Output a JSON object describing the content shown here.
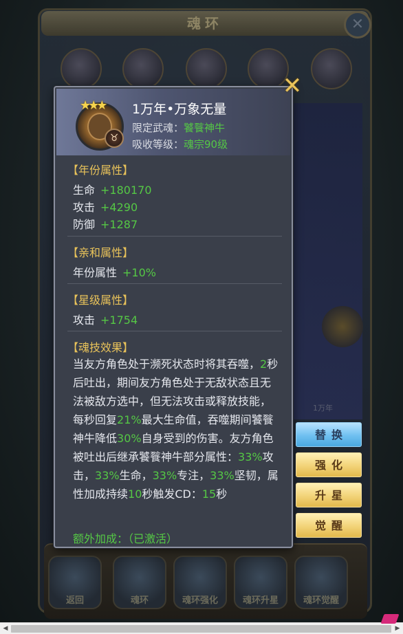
{
  "background": {
    "window_title": "魂环",
    "faint_label": "1万年",
    "bottom_nav": [
      {
        "label": "返回"
      },
      {
        "label": "魂环"
      },
      {
        "label": "魂环强化"
      },
      {
        "label": "魂环升星"
      },
      {
        "label": "魂环觉醒"
      }
    ]
  },
  "popup": {
    "stars": 3,
    "ring_name": "1万年•万象无量",
    "limit_label": "限定武魂：",
    "limit_value": "饕餮神牛",
    "absorb_label": "吸收等级：",
    "absorb_value": "魂宗90级",
    "year_attr": {
      "title": "【年份属性】",
      "items": [
        {
          "name": "生命",
          "value": "+180170"
        },
        {
          "name": "攻击",
          "value": "+4290"
        },
        {
          "name": "防御",
          "value": "+1287"
        }
      ]
    },
    "affinity_attr": {
      "title": "【亲和属性】",
      "items": [
        {
          "name": "年份属性",
          "value": "+10%"
        }
      ]
    },
    "star_attr": {
      "title": "【星级属性】",
      "items": [
        {
          "name": "攻击",
          "value": "+1754"
        }
      ]
    },
    "skill": {
      "title": "【魂技效果】",
      "segments": [
        {
          "t": "当友方角色处于濒死状态时将其吞噬，",
          "g": false
        },
        {
          "t": "2",
          "g": true
        },
        {
          "t": "秒后吐出，期间友方角色处于无敌状态且无法被敌方选中，但无法攻击或释放技能，每秒回复",
          "g": false
        },
        {
          "t": "21%",
          "g": true
        },
        {
          "t": "最大生命值，吞噬期间饕餮神牛降低",
          "g": false
        },
        {
          "t": "30%",
          "g": true
        },
        {
          "t": "自身受到的伤害。友方角色被吐出后继承饕餮神牛部分属性：",
          "g": false
        },
        {
          "t": "33%",
          "g": true
        },
        {
          "t": "攻击，",
          "g": false
        },
        {
          "t": "33%",
          "g": true
        },
        {
          "t": "生命，",
          "g": false
        },
        {
          "t": "33%",
          "g": true
        },
        {
          "t": "专注，",
          "g": false
        },
        {
          "t": "33%",
          "g": true
        },
        {
          "t": "坚韧，属性加成持续",
          "g": false
        },
        {
          "t": "10",
          "g": true
        },
        {
          "t": "秒触发CD：",
          "g": false
        },
        {
          "t": "15",
          "g": true
        },
        {
          "t": "秒",
          "g": false
        }
      ]
    },
    "bonus": "额外加成：（已激活）"
  },
  "actions": {
    "replace": "替换",
    "enhance": "强化",
    "star_up": "升星",
    "awaken": "觉醒"
  },
  "colors": {
    "gold_text": "#e9c35a",
    "green_text": "#55c845",
    "popup_bg": "#3a3f4a"
  }
}
